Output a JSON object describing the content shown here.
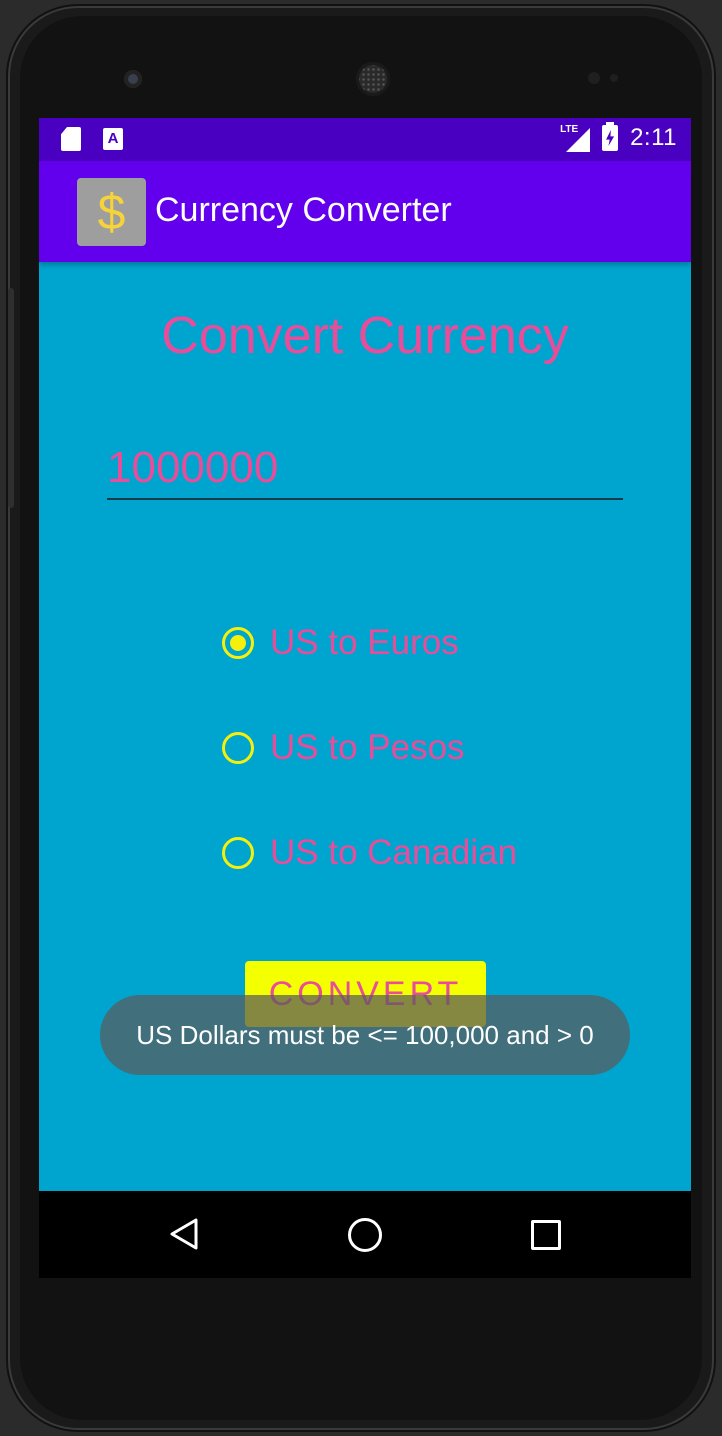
{
  "status_bar": {
    "time": "2:11",
    "network": "LTE",
    "icons": [
      "sd-card-icon",
      "text-input-icon",
      "lte-signal-icon",
      "battery-charging-icon"
    ]
  },
  "app_bar": {
    "logo_glyph": "$",
    "title": "Currency Converter"
  },
  "main": {
    "heading": "Convert Currency",
    "amount_value": "1000000",
    "options": [
      {
        "label": "US to Euros",
        "checked": true
      },
      {
        "label": "US to Pesos",
        "checked": false
      },
      {
        "label": "US to Canadian",
        "checked": false
      }
    ],
    "convert_label": "CONVERT",
    "toast_message": "US Dollars must be <= 100,000 and > 0"
  },
  "colors": {
    "status_bar": "#4a00c0",
    "app_bar": "#6200ee",
    "background": "#00a5cf",
    "accent_text": "#e94d9a",
    "radio": "#f4f00b",
    "button": "#f4ff00"
  },
  "nav_bar": {
    "icons": [
      "back-icon",
      "home-icon",
      "recents-icon"
    ]
  }
}
